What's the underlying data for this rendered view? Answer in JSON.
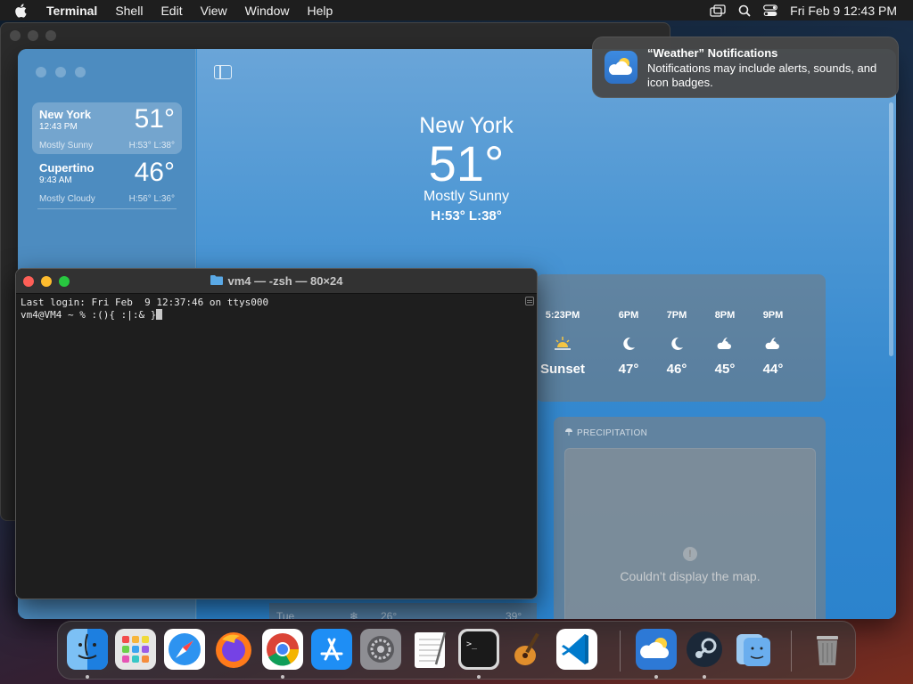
{
  "menubar": {
    "app_name": "Terminal",
    "items": [
      "Shell",
      "Edit",
      "View",
      "Window",
      "Help"
    ],
    "clock": "Fri Feb 9  12:43 PM"
  },
  "notification": {
    "title": "“Weather” Notifications",
    "body": "Notifications may include alerts, sounds, and icon badges."
  },
  "weather": {
    "locations": [
      {
        "city": "New York",
        "time": "12:43 PM",
        "temp": "51°",
        "condition": "Mostly Sunny",
        "hl": "H:53°  L:38°"
      },
      {
        "city": "Cupertino",
        "time": "9:43 AM",
        "temp": "46°",
        "condition": "Mostly Cloudy",
        "hl": "H:56°  L:36°"
      }
    ],
    "hero": {
      "city": "New York",
      "temp": "51°",
      "condition": "Mostly Sunny",
      "hl": "H:53°  L:38°"
    },
    "hourly": [
      {
        "hour": "5:23PM",
        "icon": "sunset-icon",
        "value": "Sunset"
      },
      {
        "hour": "6PM",
        "icon": "moon-cloud-icon",
        "value": "47°"
      },
      {
        "hour": "7PM",
        "icon": "moon-cloud-icon",
        "value": "46°"
      },
      {
        "hour": "8PM",
        "icon": "cloud-moon-icon",
        "value": "45°"
      },
      {
        "hour": "9PM",
        "icon": "cloud-moon-icon",
        "value": "44°"
      }
    ],
    "precipitation": {
      "heading": "PRECIPITATION",
      "message": "Couldn’t display the map."
    },
    "bottom_strip": {
      "day": "Tue",
      "low": "26°",
      "high": "39°"
    }
  },
  "terminal": {
    "title": "vm4 — -zsh — 80×24",
    "line1": "Last login: Fri Feb  9 12:37:46 on ttys000",
    "line2": "vm4@VM4 ~ % :(){ :|:& }"
  },
  "dock": {
    "apps": [
      "Finder",
      "Launchpad",
      "Safari",
      "Firefox",
      "Chrome",
      "App Store",
      "System Preferences",
      "TextEdit",
      "Terminal",
      "GarageBand",
      "VS Code",
      "Weather",
      "Steam",
      "Finder",
      "Trash"
    ]
  }
}
